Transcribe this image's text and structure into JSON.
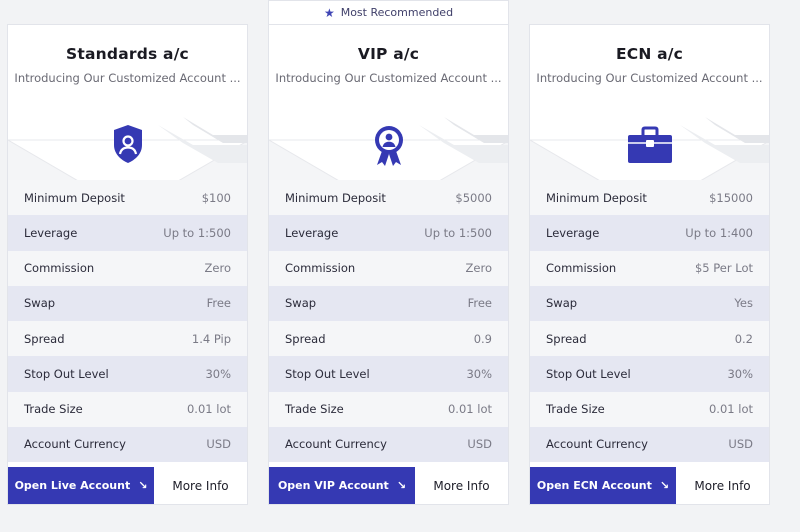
{
  "recommended": {
    "label": "Most Recommended",
    "icon": "star-icon"
  },
  "cards": [
    {
      "title": "Standards a/c",
      "subtitle": "Introducing Our Customized Account ...",
      "icon": "user-shield-icon",
      "rows": [
        {
          "label": "Minimum Deposit",
          "value": "$100"
        },
        {
          "label": "Leverage",
          "value": "Up to 1:500"
        },
        {
          "label": "Commission",
          "value": "Zero"
        },
        {
          "label": "Swap",
          "value": "Free"
        },
        {
          "label": "Spread",
          "value": "1.4 Pip"
        },
        {
          "label": "Stop Out Level",
          "value": "30%"
        },
        {
          "label": "Trade Size",
          "value": "0.01 lot"
        },
        {
          "label": "Account Currency",
          "value": "USD"
        }
      ],
      "primary_button": "Open Live Account",
      "secondary_button": "More Info"
    },
    {
      "title": "VIP a/c",
      "subtitle": "Introducing Our Customized Account ...",
      "icon": "award-badge-icon",
      "rows": [
        {
          "label": "Minimum Deposit",
          "value": "$5000"
        },
        {
          "label": "Leverage",
          "value": "Up to 1:500"
        },
        {
          "label": "Commission",
          "value": "Zero"
        },
        {
          "label": "Swap",
          "value": "Free"
        },
        {
          "label": "Spread",
          "value": "0.9"
        },
        {
          "label": "Stop Out Level",
          "value": "30%"
        },
        {
          "label": "Trade Size",
          "value": "0.01 lot"
        },
        {
          "label": "Account Currency",
          "value": "USD"
        }
      ],
      "primary_button": "Open VIP Account",
      "secondary_button": "More Info"
    },
    {
      "title": "ECN a/c",
      "subtitle": "Introducing Our Customized Account ...",
      "icon": "briefcase-icon",
      "rows": [
        {
          "label": "Minimum Deposit",
          "value": "$15000"
        },
        {
          "label": "Leverage",
          "value": "Up to 1:400"
        },
        {
          "label": "Commission",
          "value": "$5 Per Lot"
        },
        {
          "label": "Swap",
          "value": "Yes"
        },
        {
          "label": "Spread",
          "value": "0.2"
        },
        {
          "label": "Stop Out Level",
          "value": "30%"
        },
        {
          "label": "Trade Size",
          "value": "0.01 lot"
        },
        {
          "label": "Account Currency",
          "value": "USD"
        }
      ],
      "primary_button": "Open ECN Account",
      "secondary_button": "More Info"
    }
  ],
  "colors": {
    "accent": "#3539b3",
    "row_alt": "#e5e7f2",
    "row": "#f5f6f8",
    "page_bg": "#f2f3f5"
  }
}
